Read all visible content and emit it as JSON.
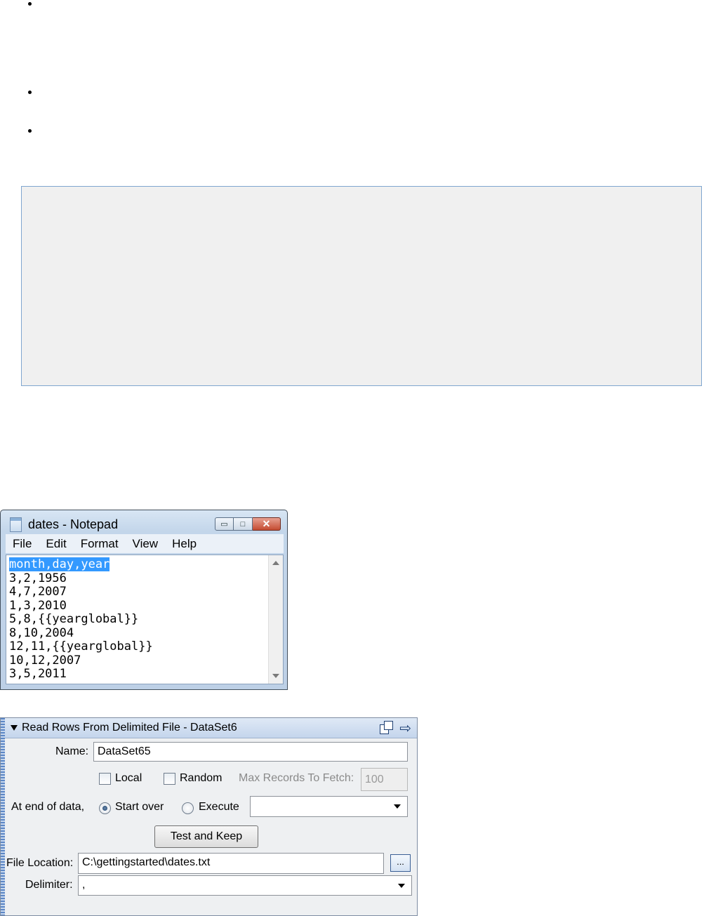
{
  "bullets": [
    {
      "name": "bullet-1"
    },
    {
      "name": "bullet-2"
    },
    {
      "name": "bullet-3"
    }
  ],
  "notepad": {
    "title": "dates - Notepad",
    "menu": [
      "File",
      "Edit",
      "Format",
      "View",
      "Help"
    ],
    "lines": [
      "month,day,year",
      "3,2,1956",
      "4,7,2007",
      "1,3,2010",
      "5,8,{{yearglobal}}",
      "8,10,2004",
      "12,11,{{yearglobal}}",
      "10,12,2007",
      "3,5,2011"
    ],
    "selected_line": 0,
    "buttons": {
      "minimize": "▭",
      "maximize": "□",
      "close": "✕"
    }
  },
  "panel": {
    "title": "Read Rows From Delimited File - DataSet6",
    "name_label": "Name:",
    "name_value": "DataSet65",
    "local_label": "Local",
    "local_checked": false,
    "random_label": "Random",
    "random_checked": false,
    "max_records_label": "Max Records To Fetch:",
    "max_records_value": "100",
    "end_of_data_label": "At end of data,",
    "start_over_label": "Start over",
    "start_over_selected": true,
    "execute_label": "Execute",
    "execute_selected": false,
    "execute_value": "",
    "test_keep_label": "Test and Keep",
    "file_location_label": "File Location:",
    "file_location_value": "C:\\gettingstarted\\dates.txt",
    "browse_label": "...",
    "delimiter_label": "Delimiter:",
    "delimiter_value": ","
  }
}
